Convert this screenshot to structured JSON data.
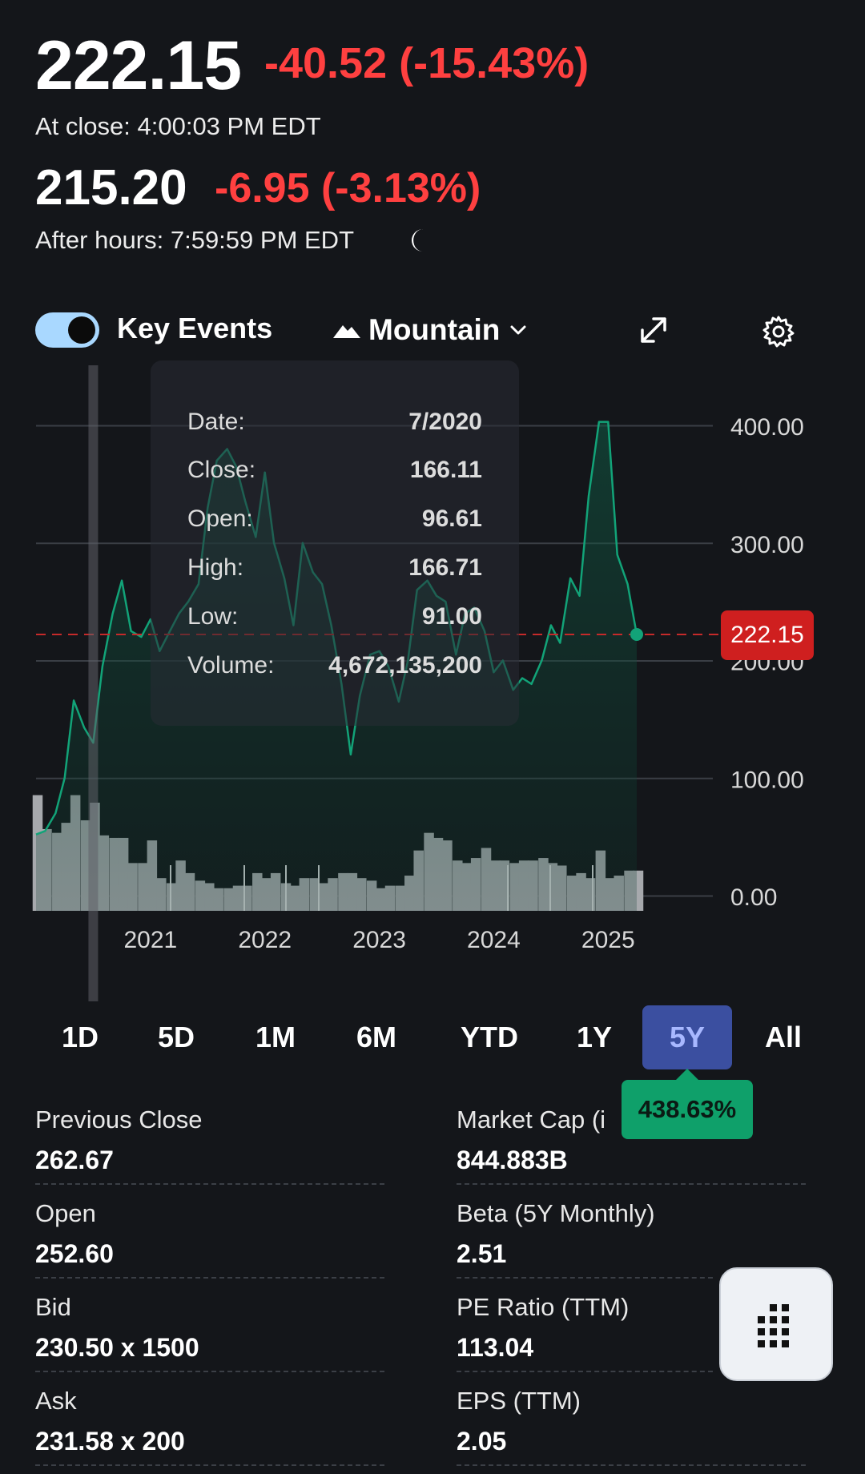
{
  "quote": {
    "price": "222.15",
    "change": "-40.52 (-15.43%)",
    "close_time": "At close: 4:00:03 PM EDT",
    "after_hours_price": "215.20",
    "after_hours_change": "-6.95 (-3.13%)",
    "after_hours_time": "After hours: 7:59:59 PM EDT"
  },
  "toolbar": {
    "key_events_label": "Key Events",
    "key_events_on": true,
    "chart_type_label": "Mountain",
    "icons": [
      "mountain-icon",
      "chevron-down-icon",
      "expand-icon",
      "gear-icon"
    ]
  },
  "tooltip": {
    "rows": [
      {
        "key": "Date:",
        "value": "7/2020"
      },
      {
        "key": "Close:",
        "value": "166.11"
      },
      {
        "key": "Open:",
        "value": "96.61"
      },
      {
        "key": "High:",
        "value": "166.71"
      },
      {
        "key": "Low:",
        "value": "91.00"
      },
      {
        "key": "Volume:",
        "value": "4,672,135,200"
      }
    ]
  },
  "current_price_label": "222.15",
  "chart_data": {
    "type": "area",
    "x_tick_labels": [
      "2021",
      "2022",
      "2023",
      "2024",
      "2025"
    ],
    "y_tick_labels": [
      "400.00",
      "300.00",
      "200.00",
      "100.00",
      "0.00"
    ],
    "ylim": [
      0,
      400
    ],
    "xlim": [
      2020.0,
      2025.6
    ],
    "reference_line": 222.15,
    "crosshair_x": 2020.5,
    "series": [
      {
        "x": [
          2020.0,
          2020.08,
          2020.17,
          2020.25,
          2020.33,
          2020.42,
          2020.5,
          2020.58,
          2020.67,
          2020.75,
          2020.83,
          2020.92,
          2021.0,
          2021.08,
          2021.17,
          2021.25,
          2021.33,
          2021.42,
          2021.5,
          2021.58,
          2021.67,
          2021.75,
          2021.83,
          2021.92,
          2022.0,
          2022.08,
          2022.17,
          2022.25,
          2022.33,
          2022.42,
          2022.5,
          2022.58,
          2022.67,
          2022.75,
          2022.83,
          2022.92,
          2023.0,
          2023.08,
          2023.17,
          2023.25,
          2023.33,
          2023.42,
          2023.5,
          2023.58,
          2023.67,
          2023.75,
          2023.83,
          2023.92,
          2024.0,
          2024.08,
          2024.17,
          2024.25,
          2024.33,
          2024.42,
          2024.5,
          2024.58,
          2024.67,
          2024.75,
          2024.83,
          2024.92,
          2025.0,
          2025.08,
          2025.17,
          2025.25
        ],
        "values": [
          52,
          55,
          70,
          100,
          166,
          143,
          130,
          195,
          240,
          268,
          225,
          220,
          235,
          208,
          225,
          240,
          250,
          265,
          330,
          370,
          380,
          365,
          335,
          305,
          360,
          300,
          270,
          230,
          300,
          275,
          265,
          230,
          180,
          120,
          170,
          205,
          208,
          195,
          165,
          200,
          260,
          268,
          255,
          250,
          205,
          240,
          245,
          225,
          190,
          200,
          175,
          185,
          180,
          200,
          230,
          215,
          270,
          255,
          340,
          403,
          403,
          290,
          265,
          222
        ]
      }
    ],
    "volume_ylim": [
      0,
      100
    ],
    "volume": [
      92,
      65,
      62,
      70,
      92,
      72,
      86,
      60,
      58,
      58,
      38,
      38,
      56,
      26,
      22,
      40,
      30,
      24,
      22,
      18,
      18,
      20,
      20,
      30,
      26,
      30,
      22,
      20,
      26,
      26,
      22,
      26,
      30,
      30,
      26,
      24,
      18,
      20,
      20,
      28,
      48,
      62,
      58,
      56,
      40,
      38,
      42,
      50,
      40,
      40,
      38,
      40,
      40,
      42,
      38,
      36,
      28,
      30,
      26,
      48,
      26,
      28,
      32,
      32
    ]
  },
  "range_tabs": [
    {
      "label": "1D",
      "active": false
    },
    {
      "label": "5D",
      "active": false
    },
    {
      "label": "1M",
      "active": false
    },
    {
      "label": "6M",
      "active": false
    },
    {
      "label": "YTD",
      "active": false
    },
    {
      "label": "1Y",
      "active": false
    },
    {
      "label": "5Y",
      "active": true
    },
    {
      "label": "All",
      "active": false
    }
  ],
  "range_return": "438.63%",
  "stats": {
    "left": [
      {
        "label": "Previous Close",
        "value": "262.67"
      },
      {
        "label": "Open",
        "value": "252.60"
      },
      {
        "label": "Bid",
        "value": "230.50 x 1500"
      },
      {
        "label": "Ask",
        "value": "231.58 x 200"
      }
    ],
    "right": [
      {
        "label": "Market Cap (i",
        "value": "844.883B"
      },
      {
        "label": "Beta (5Y Monthly)",
        "value": "2.51"
      },
      {
        "label": "PE Ratio (TTM)",
        "value": "113.04"
      },
      {
        "label": "EPS (TTM)",
        "value": "2.05"
      }
    ]
  },
  "colors": {
    "background": "#14161a",
    "negative": "#ff4040",
    "line": "#12a378",
    "badge_red": "#cf1f1f",
    "tab_active": "#3b4fa0",
    "return_green": "#0fa06a"
  }
}
